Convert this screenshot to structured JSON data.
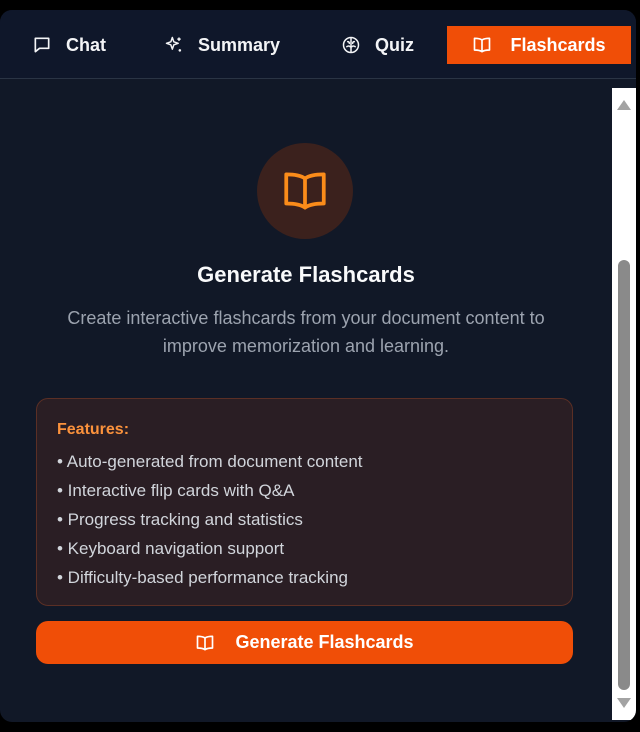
{
  "tabs": {
    "chat": "Chat",
    "summary": "Summary",
    "quiz": "Quiz",
    "flashcards": "Flashcards"
  },
  "active_tab": "flashcards",
  "main": {
    "icon": "book-open-icon",
    "title": "Generate Flashcards",
    "description": "Create interactive flashcards from your document content to improve memorization and learning.",
    "features": {
      "heading": "Features:",
      "items": [
        "• Auto-generated from document content",
        "• Interactive flip cards with Q&A",
        "• Progress tracking and statistics",
        "• Keyboard navigation support",
        "• Difficulty-based performance tracking"
      ]
    },
    "button_label": "Generate Flashcards"
  },
  "colors": {
    "accent": "#f04e07",
    "background": "#111827",
    "feature_heading": "#fb923c"
  }
}
